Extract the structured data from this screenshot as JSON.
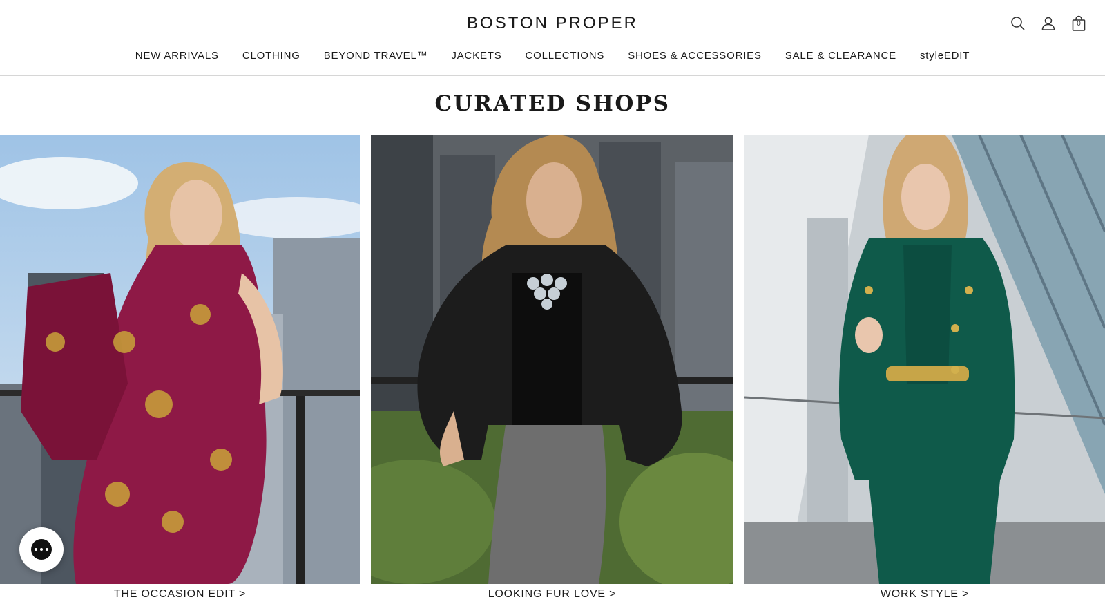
{
  "header": {
    "logo": "BOSTON PROPER",
    "icons": [
      "search-icon",
      "account-icon",
      "bag-icon"
    ],
    "bag_count": "0"
  },
  "nav": {
    "items": [
      {
        "label": "NEW ARRIVALS"
      },
      {
        "label": "CLOTHING"
      },
      {
        "label": "BEYOND TRAVEL™"
      },
      {
        "label": "JACKETS"
      },
      {
        "label": "COLLECTIONS"
      },
      {
        "label": "SHOES & ACCESSORIES"
      },
      {
        "label": "SALE & CLEARANCE"
      },
      {
        "label": "styleEDIT"
      }
    ]
  },
  "main": {
    "title": "CURATED SHOPS",
    "tiles": [
      {
        "caption": "THE OCCASION EDIT >"
      },
      {
        "caption": "LOOKING FUR LOVE >"
      },
      {
        "caption": "WORK STYLE >"
      }
    ]
  },
  "chat": {
    "icon": "chat-icon"
  },
  "colors": {
    "text": "#1a1a1a",
    "divider": "#d6d6d6",
    "tile1_dress": "#8e1946",
    "tile2_coat": "#1c1c1c",
    "tile3_suit": "#0f5a4a"
  }
}
